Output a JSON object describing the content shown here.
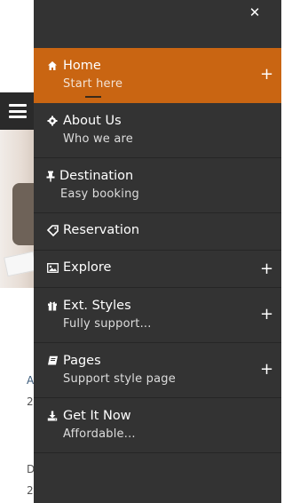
{
  "background": {
    "texts": [
      "A",
      "2",
      "D",
      "2"
    ]
  },
  "menu": {
    "items": [
      {
        "label": "Home",
        "sub": "Start here",
        "icon": "home-icon",
        "expandable": true,
        "active": true
      },
      {
        "label": "About Us",
        "sub": "Who we are",
        "icon": "gear-icon",
        "expandable": false
      },
      {
        "label": "Destination",
        "sub": "Easy booking",
        "icon": "pin-icon",
        "expandable": false
      },
      {
        "label": "Reservation",
        "sub": "",
        "icon": "tag-icon",
        "expandable": false
      },
      {
        "label": "Explore",
        "sub": "",
        "icon": "image-icon",
        "expandable": true
      },
      {
        "label": "Ext. Styles",
        "sub": "Fully support...",
        "icon": "gift-icon",
        "expandable": true
      },
      {
        "label": "Pages",
        "sub": "Support style page",
        "icon": "book-icon",
        "expandable": true
      },
      {
        "label": "Get It Now",
        "sub": "Affordable...",
        "icon": "download-icon",
        "expandable": false
      }
    ],
    "expand_symbol": "+",
    "close_symbol": "✕"
  },
  "colors": {
    "sidebar_bg": "#333333",
    "active_bg": "#c96512"
  }
}
